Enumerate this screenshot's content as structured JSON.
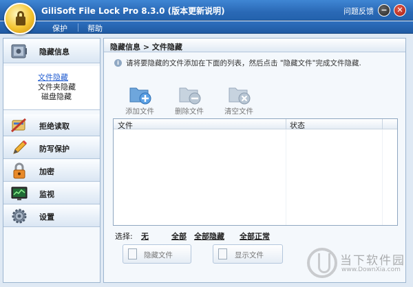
{
  "window": {
    "title": "GiliSoft File Lock Pro 8.3.0 (版本更新说明)",
    "feedback": "问题反馈",
    "minimize_glyph": "−",
    "close_glyph": "✕"
  },
  "menu": {
    "protect": "保护",
    "help": "帮助"
  },
  "sidebar": {
    "hide_info": "隐藏信息",
    "sub_items": [
      "文件隐藏",
      "文件夹隐藏",
      "磁盘隐藏"
    ],
    "deny_read": "拒绝读取",
    "write_protect": "防写保护",
    "encrypt": "加密",
    "monitor": "监视",
    "settings": "设置"
  },
  "content": {
    "breadcrumb": "隐藏信息 > 文件隐藏",
    "info_glyph": "i",
    "instruction": "请将要隐藏的文件添加在下面的列表，然后点击 \"隐藏文件\"完成文件隐藏.",
    "toolbar": {
      "add_file": "添加文件",
      "delete_file": "删除文件",
      "clear_files": "清空文件"
    },
    "table": {
      "col_file": "文件",
      "col_status": "状态"
    },
    "select": {
      "label": "选择:",
      "none": "无",
      "all": "全部",
      "all_hidden": "全部隐藏",
      "all_normal": "全部正常"
    },
    "hide_button": "隐藏文件",
    "show_button": "显示文件"
  },
  "watermark": {
    "name": "当下软件园",
    "url": "www.DownXia.com"
  },
  "colors": {
    "titlebar": "#2a69b6",
    "accent_link": "#1f5bd0"
  }
}
